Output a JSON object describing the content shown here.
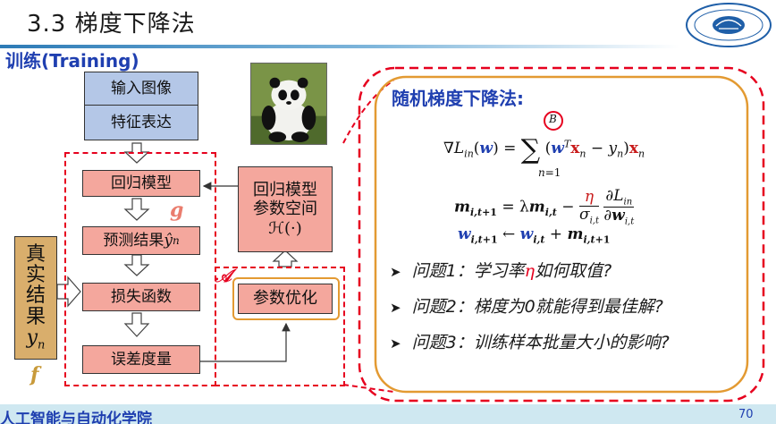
{
  "header": {
    "title": "3.3 梯度下降法",
    "subtitle": "训练(Training)"
  },
  "diagram": {
    "input_image": "输入图像",
    "feature_repr": "特征表达",
    "regression_model": "回归模型",
    "prediction": "预测结果",
    "prediction_symbol": "ŷ",
    "prediction_sub": "n",
    "loss": "损失函数",
    "error": "误差度量",
    "true_chars": [
      "真",
      "实",
      "结",
      "果"
    ],
    "true_symbol": "y",
    "true_sub": "n",
    "param_space_line1": "回归模型",
    "param_space_line2": "参数空间",
    "param_space_symbol": "ℋ(·)",
    "param_opt": "参数优化",
    "label_g": "g",
    "label_f": "f",
    "label_A": "𝒜"
  },
  "sgd": {
    "title": "随机梯度下降法:",
    "batch_symbol": "B",
    "questions": [
      "问题1：学习率",
      "如何取值?",
      "问题2：梯度为0就能得到最佳解?",
      "问题3：训练样本批量大小的影响?"
    ],
    "eta": "η"
  },
  "footer": {
    "school": "人工智能与自动化学院",
    "page": "70"
  },
  "colors": {
    "accent_blue": "#1f3fb0",
    "dash_red": "#e6001e",
    "orange": "#e39a32",
    "box_blue": "#b4c7e7",
    "box_pink": "#f4a79d",
    "box_tan": "#d9ae6c"
  }
}
